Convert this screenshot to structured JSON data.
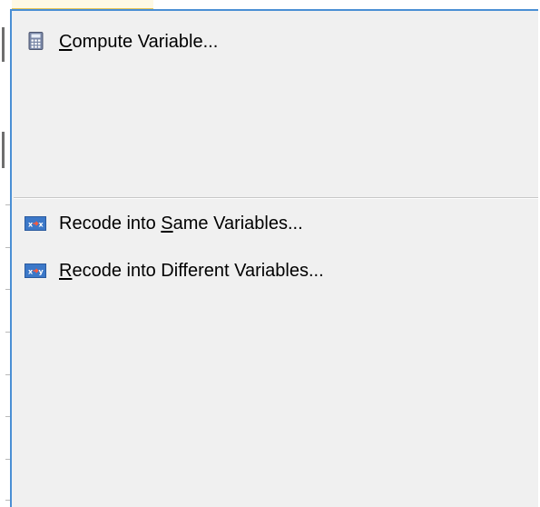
{
  "menu": {
    "items": [
      {
        "id": "compute-variable",
        "label_before": "",
        "label_mnemonic": "C",
        "label_after": "ompute Variable...",
        "icon": "calculator-icon"
      },
      {
        "id": "recode-same",
        "label_before": "Recode into ",
        "label_mnemonic": "S",
        "label_after": "ame Variables...",
        "icon": "recode-same-icon"
      },
      {
        "id": "recode-different",
        "label_before": "",
        "label_mnemonic": "R",
        "label_after": "ecode into Different Variables...",
        "icon": "recode-different-icon"
      }
    ]
  },
  "colors": {
    "menu_background": "#f0f0f0",
    "menu_border": "#4a8fd4",
    "separator": "#c7c7c7",
    "icon_blue": "#3c78c8",
    "top_accent": "#e8c655"
  }
}
